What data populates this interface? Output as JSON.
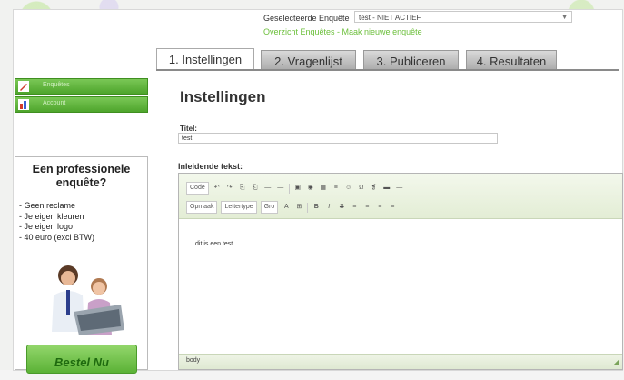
{
  "header": {
    "selected_label": "Geselecteerde Enquête",
    "selected_value": "test - NIET ACTIEF",
    "links": "Overzicht Enquêtes - Maak nieuwe enquête"
  },
  "tabs": [
    {
      "label": "1. Instellingen",
      "active": true
    },
    {
      "label": "2. Vragenlijst",
      "active": false
    },
    {
      "label": "3. Publiceren",
      "active": false
    },
    {
      "label": "4. Resultaten",
      "active": false
    }
  ],
  "sidebar": {
    "items": [
      {
        "label": "Enquêtes",
        "icon": "pencil-icon"
      },
      {
        "label": "Account",
        "icon": "chart-icon"
      }
    ],
    "promo": {
      "title": "Een professionele enquête?",
      "bullets": [
        "- Geen reclame",
        "- Je eigen kleuren",
        "- Je eigen logo",
        "- 40 euro (excl BTW)"
      ],
      "button": "Bestel Nu"
    }
  },
  "main": {
    "heading": "Instellingen",
    "title_label": "Titel:",
    "title_value": "test",
    "intro_label": "Inleidende tekst:",
    "editor": {
      "toolbar_row1": [
        "Code",
        "↶",
        "↷",
        "⎘",
        "⎗",
        "—",
        "—",
        "▣",
        "◉",
        "▦",
        "≡",
        "☺",
        "Ω",
        "❡",
        "▬",
        "—"
      ],
      "toolbar_row2": [
        "Opmaak",
        "Lettertype",
        "Gro",
        "A",
        "⊞",
        "B",
        "I",
        "S",
        "≡",
        "≡",
        "≡",
        "≡"
      ],
      "body_text": "dit is een test",
      "status": "body"
    }
  },
  "colors": {
    "accent_green": "#5bb236",
    "link_green": "#6bbf3a",
    "tab_active": "#ffffff",
    "tab_inactive": "#a9a9a9"
  }
}
